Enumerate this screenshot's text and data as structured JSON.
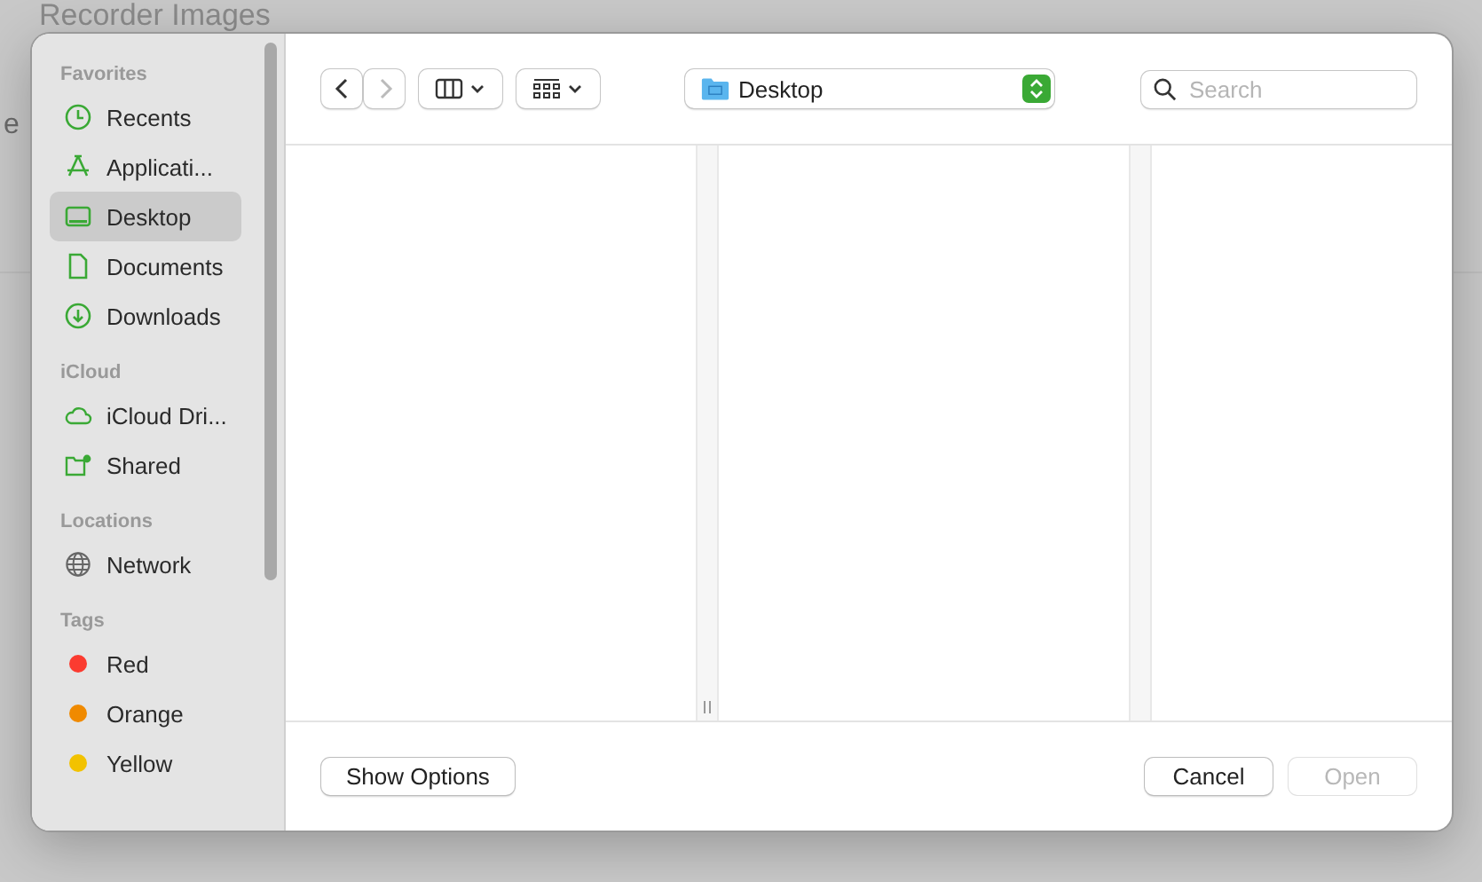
{
  "background": {
    "title": "Recorder Images",
    "text": "e"
  },
  "sidebar": {
    "sections": [
      {
        "header": "Favorites",
        "items": [
          {
            "kind": "clock",
            "label": "Recents",
            "selected": false
          },
          {
            "kind": "apps",
            "label": "Applicati...",
            "selected": false
          },
          {
            "kind": "desktop",
            "label": "Desktop",
            "selected": true
          },
          {
            "kind": "document",
            "label": "Documents",
            "selected": false
          },
          {
            "kind": "download",
            "label": "Downloads",
            "selected": false
          }
        ]
      },
      {
        "header": "iCloud",
        "items": [
          {
            "kind": "cloud",
            "label": "iCloud Dri...",
            "selected": false
          },
          {
            "kind": "shared",
            "label": "Shared",
            "selected": false
          }
        ]
      },
      {
        "header": "Locations",
        "items": [
          {
            "kind": "network",
            "label": "Network",
            "selected": false
          }
        ]
      },
      {
        "header": "Tags",
        "items": [
          {
            "kind": "tag",
            "label": "Red",
            "color": "#fb3b30",
            "selected": false
          },
          {
            "kind": "tag",
            "label": "Orange",
            "color": "#f08a00",
            "selected": false
          },
          {
            "kind": "tag",
            "label": "Yellow",
            "color": "#f2c200",
            "selected": false
          }
        ]
      }
    ]
  },
  "toolbar": {
    "location": "Desktop",
    "search": {
      "placeholder": "Search"
    }
  },
  "footer": {
    "options_button": "Show Options",
    "cancel_button": "Cancel",
    "open_button": {
      "label": "Open",
      "disabled": true
    }
  }
}
